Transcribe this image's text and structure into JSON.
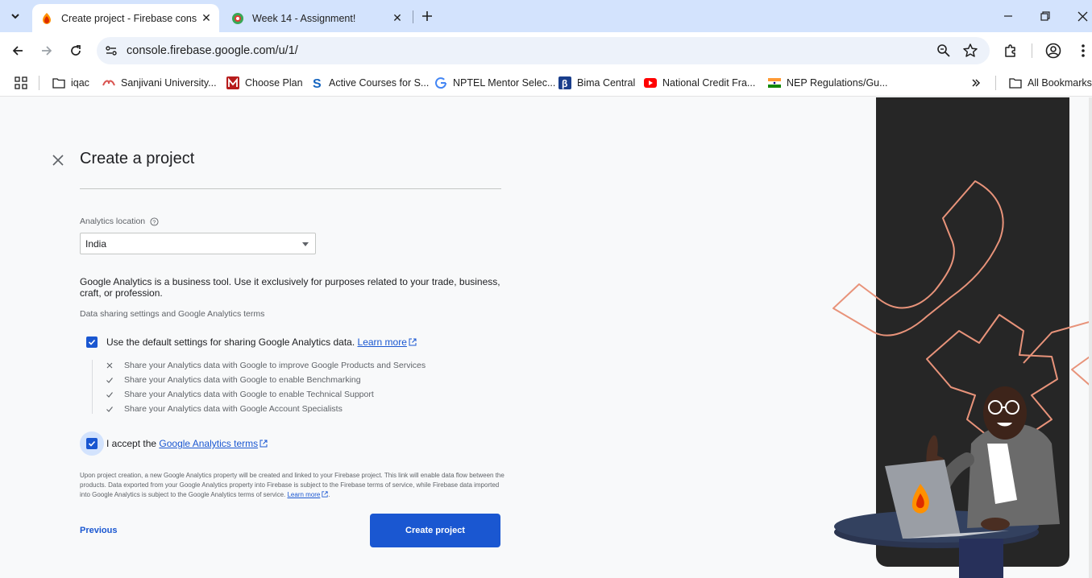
{
  "browser": {
    "tabs": [
      {
        "title": "Create project - Firebase conso",
        "active": true
      },
      {
        "title": "Week 14 - Assignment!",
        "active": false
      }
    ],
    "url": "console.firebase.google.com/u/1/",
    "bookmarks": [
      "iqac",
      "Sanjivani University...",
      "Choose Plan",
      "Active Courses for S...",
      "NPTEL Mentor Selec...",
      "Bima Central",
      "National Credit Fra...",
      "NEP Regulations/Gu..."
    ],
    "all_bookmarks_label": "All Bookmarks"
  },
  "page": {
    "title": "Create a project",
    "analytics_location_label": "Analytics location",
    "analytics_location_value": "India",
    "business_notice": "Google Analytics is a business tool. Use it exclusively for purposes related to your trade, business, craft, or profession.",
    "data_sharing_heading": "Data sharing settings and Google Analytics terms",
    "default_settings_label": "Use the default settings for sharing Google Analytics data.",
    "default_settings_checked": true,
    "learn_more": "Learn more",
    "sharing_options": [
      {
        "text": "Share your Analytics data with Google to improve Google Products and Services",
        "enabled": false
      },
      {
        "text": "Share your Analytics data with Google to enable Benchmarking",
        "enabled": true
      },
      {
        "text": "Share your Analytics data with Google to enable Technical Support",
        "enabled": true
      },
      {
        "text": "Share your Analytics data with Google Account Specialists",
        "enabled": true
      }
    ],
    "accept_prefix": "I accept the",
    "accept_link": "Google Analytics terms",
    "accept_checked": true,
    "fine_print": "Upon project creation, a new Google Analytics property will be created and linked to your Firebase project. This link will enable data flow between the products. Data exported from your Google Analytics property into Firebase is subject to the Firebase terms of service, while Firebase data imported into Google Analytics is subject to the Google Analytics terms of service.",
    "fine_print_link": "Learn more",
    "fine_print_end": ".",
    "previous_button": "Previous",
    "create_button": "Create project"
  },
  "colors": {
    "accent": "#1a57d1",
    "tab_strip": "#d3e3fd",
    "illustration_bg": "#262626",
    "illustration_outline": "#e8937a"
  }
}
